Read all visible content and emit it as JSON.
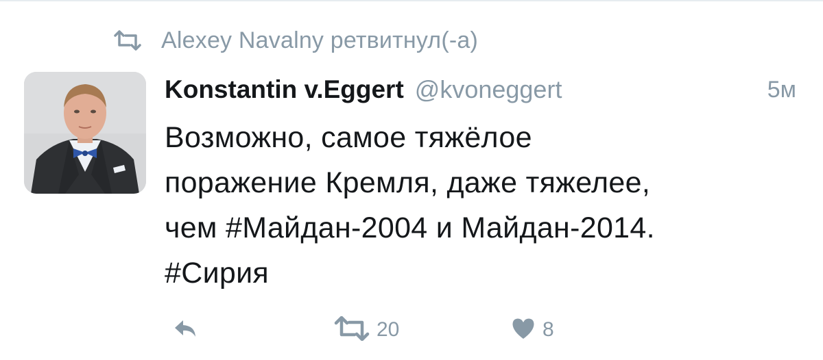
{
  "context": {
    "retweeter_text": "Alexey Navalny ретвитнул(-а)",
    "icon": "retweet-icon"
  },
  "tweet": {
    "author": {
      "display_name": "Konstantin v.Eggert",
      "handle": "@kvoneggert",
      "avatar": "profile-photo"
    },
    "time": "5м",
    "text_lines": [
      "Возможно, самое тяжёлое",
      "поражение Кремля, даже тяжелее,",
      "чем #Майдан-2004 и Майдан-2014.",
      "#Сирия"
    ],
    "actions": {
      "reply": {
        "icon": "reply-icon"
      },
      "retweet": {
        "icon": "retweet-icon",
        "count": "20"
      },
      "like": {
        "icon": "heart-icon",
        "count": "8"
      }
    }
  },
  "colors": {
    "primary_text": "#14171a",
    "secondary_text": "#8899a6",
    "background": "#ffffff"
  }
}
